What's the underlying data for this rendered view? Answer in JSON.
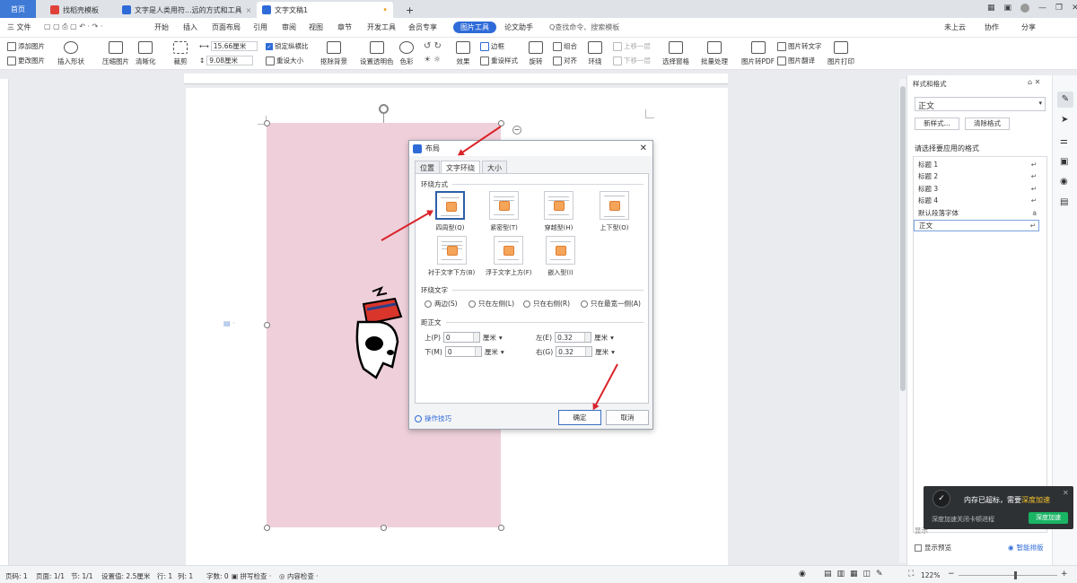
{
  "tabs": [
    {
      "label": "首页"
    },
    {
      "label": "找稻壳模板"
    },
    {
      "label": "文字是人类用符...远的方式和工具"
    },
    {
      "label": "文字文稿1"
    }
  ],
  "tab_add": "+",
  "menu": {
    "file": "三 文件",
    "items": [
      "开始",
      "插入",
      "页面布局",
      "引用",
      "审阅",
      "视图",
      "章节",
      "开发工具",
      "会员专享",
      "图片工具",
      "论文助手"
    ],
    "search": "Q查找命令、搜索模板",
    "cloud": "未上云",
    "collab": "协作",
    "share": "分享"
  },
  "ribbon": {
    "add_image": "添加图片",
    "change_image": "更改图片",
    "insert_shape": "插入形状",
    "compress": "压缩图片",
    "sharpen": "清晰化",
    "crop": "裁剪",
    "width": "15.66厘米",
    "height": "9.08厘米",
    "lock_ratio": "锁定纵横比",
    "reset_size": "重设大小",
    "cutout": "抠除背景",
    "transparent": "设置透明色",
    "color": "色彩",
    "effect": "效果",
    "border": "边框",
    "reset_style": "重设样式",
    "rotate": "旋转",
    "group": "组合",
    "align": "对齐",
    "wrap": "环绕",
    "bring_forward": "上移一层",
    "send_backward": "下移一层",
    "select_pane": "选择窗格",
    "batch": "批量处理",
    "to_pdf": "图片转PDF",
    "to_text": "图片转文字",
    "translate": "图片翻译",
    "print": "图片打印"
  },
  "dialog": {
    "title": "布局",
    "tabs": [
      "位置",
      "文字环绕",
      "大小"
    ],
    "section_wrap": "环绕方式",
    "wrap_options": [
      "四周型(Q)",
      "紧密型(T)",
      "穿越型(H)",
      "上下型(O)",
      "衬于文字下方(B)",
      "浮于文字上方(F)",
      "嵌入型(I)"
    ],
    "section_text": "环绕文字",
    "text_options": [
      "两边(S)",
      "只在左侧(L)",
      "只在右侧(R)",
      "只在最宽一侧(A)"
    ],
    "section_distance": "距正文",
    "top_label": "上(P)",
    "top_value": "0",
    "bottom_label": "下(M)",
    "bottom_value": "0",
    "left_label": "左(E)",
    "left_value": "0.32",
    "right_label": "右(G)",
    "right_value": "0.32",
    "unit": "厘米",
    "tips": "操作技巧",
    "ok": "确定",
    "cancel": "取消"
  },
  "side_panel": {
    "title": "样式和格式",
    "current_style": "正文",
    "new_style": "新样式...",
    "clear_format": "清除格式",
    "prompt": "请选择要应用的格式",
    "styles": [
      "标题 1",
      "标题 2",
      "标题 3",
      "标题 4",
      "默认段落字体",
      "正文"
    ],
    "show_preview": "显示预览",
    "smart_layout": "智能排版",
    "show_label": "显示"
  },
  "notification": {
    "text": "内存已超标，需要",
    "highlight": "深度加速",
    "sub": "深度加速关闭卡顿进程",
    "button": "深度加速"
  },
  "status": {
    "page_num": "页码: 1",
    "pages": "页面: 1/1",
    "section": "节: 1/1",
    "setting": "设置值: 2.5厘米",
    "row": "行: 1",
    "col": "列: 1",
    "words": "字数: 0",
    "spell": "拼写检查",
    "content_check": "内容检查",
    "zoom": "122%"
  },
  "colors": {
    "accent": "#2f6bd8",
    "image_bg": "#efd0da",
    "arrow": "#d9232a"
  }
}
